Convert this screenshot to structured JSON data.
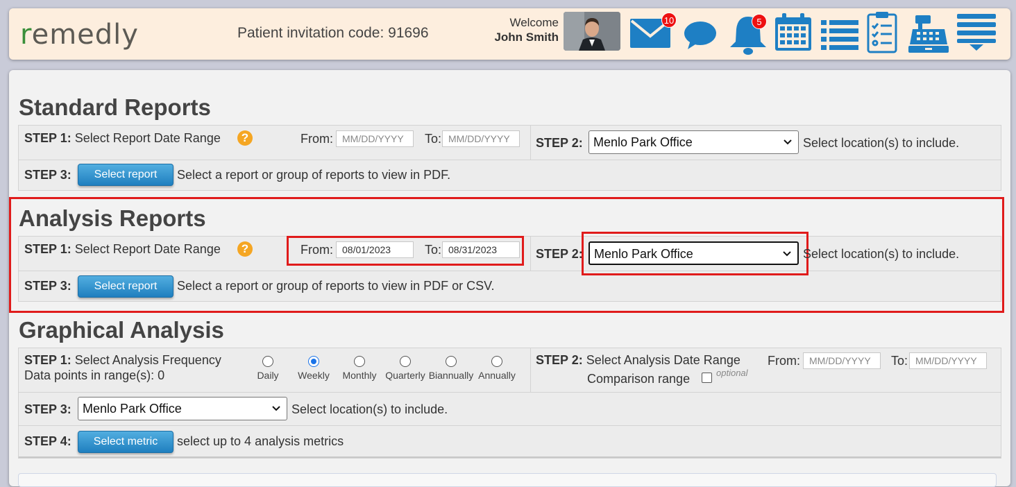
{
  "header": {
    "logo": "remedly",
    "invitation_label": "Patient invitation code: 91696",
    "welcome": "Welcome",
    "user_name": "John Smith",
    "mail_badge": "10",
    "bell_badge": "5",
    "icon_color": "#1e7fc4"
  },
  "standard": {
    "title": "Standard Reports",
    "step1_label": "STEP 1:",
    "step1_text": "Select Report Date Range",
    "from_label": "From:",
    "to_label": "To:",
    "from_placeholder": "MM/DD/YYYY",
    "to_placeholder": "MM/DD/YYYY",
    "step2_label": "STEP 2:",
    "location": "Menlo Park Office",
    "step2_text": "Select location(s) to include.",
    "step3_label": "STEP 3:",
    "button": "Select report",
    "step3_text": "Select a report or group of reports to view in PDF."
  },
  "analysis": {
    "title": "Analysis Reports",
    "step1_label": "STEP 1:",
    "step1_text": "Select Report Date Range",
    "from_label": "From:",
    "to_label": "To:",
    "from_value": "08/01/2023",
    "to_value": "08/31/2023",
    "step2_label": "STEP 2:",
    "location": "Menlo Park Office",
    "step2_text": "Select location(s) to include.",
    "step3_label": "STEP 3:",
    "button": "Select report",
    "step3_text": "Select a report or group of reports to view in PDF or CSV."
  },
  "graphical": {
    "title": "Graphical Analysis",
    "step1_label": "STEP 1:",
    "step1_text": "Select Analysis Frequency",
    "data_points": "Data points in range(s): 0",
    "frequencies": [
      "Daily",
      "Weekly",
      "Monthly",
      "Quarterly",
      "Biannually",
      "Annually"
    ],
    "selected_frequency": "Weekly",
    "step2_label": "STEP 2:",
    "step2_text": "Select Analysis Date Range",
    "from_label": "From:",
    "to_label": "To:",
    "from_placeholder": "MM/DD/YYYY",
    "to_placeholder": "MM/DD/YYYY",
    "comparison": "Comparison range",
    "optional": "optional",
    "step3_label": "STEP 3:",
    "location": "Menlo Park Office",
    "step3_text": "Select location(s) to include.",
    "step4_label": "STEP 4:",
    "button": "Select metric",
    "step4_text": "select up to 4 analysis metrics"
  }
}
